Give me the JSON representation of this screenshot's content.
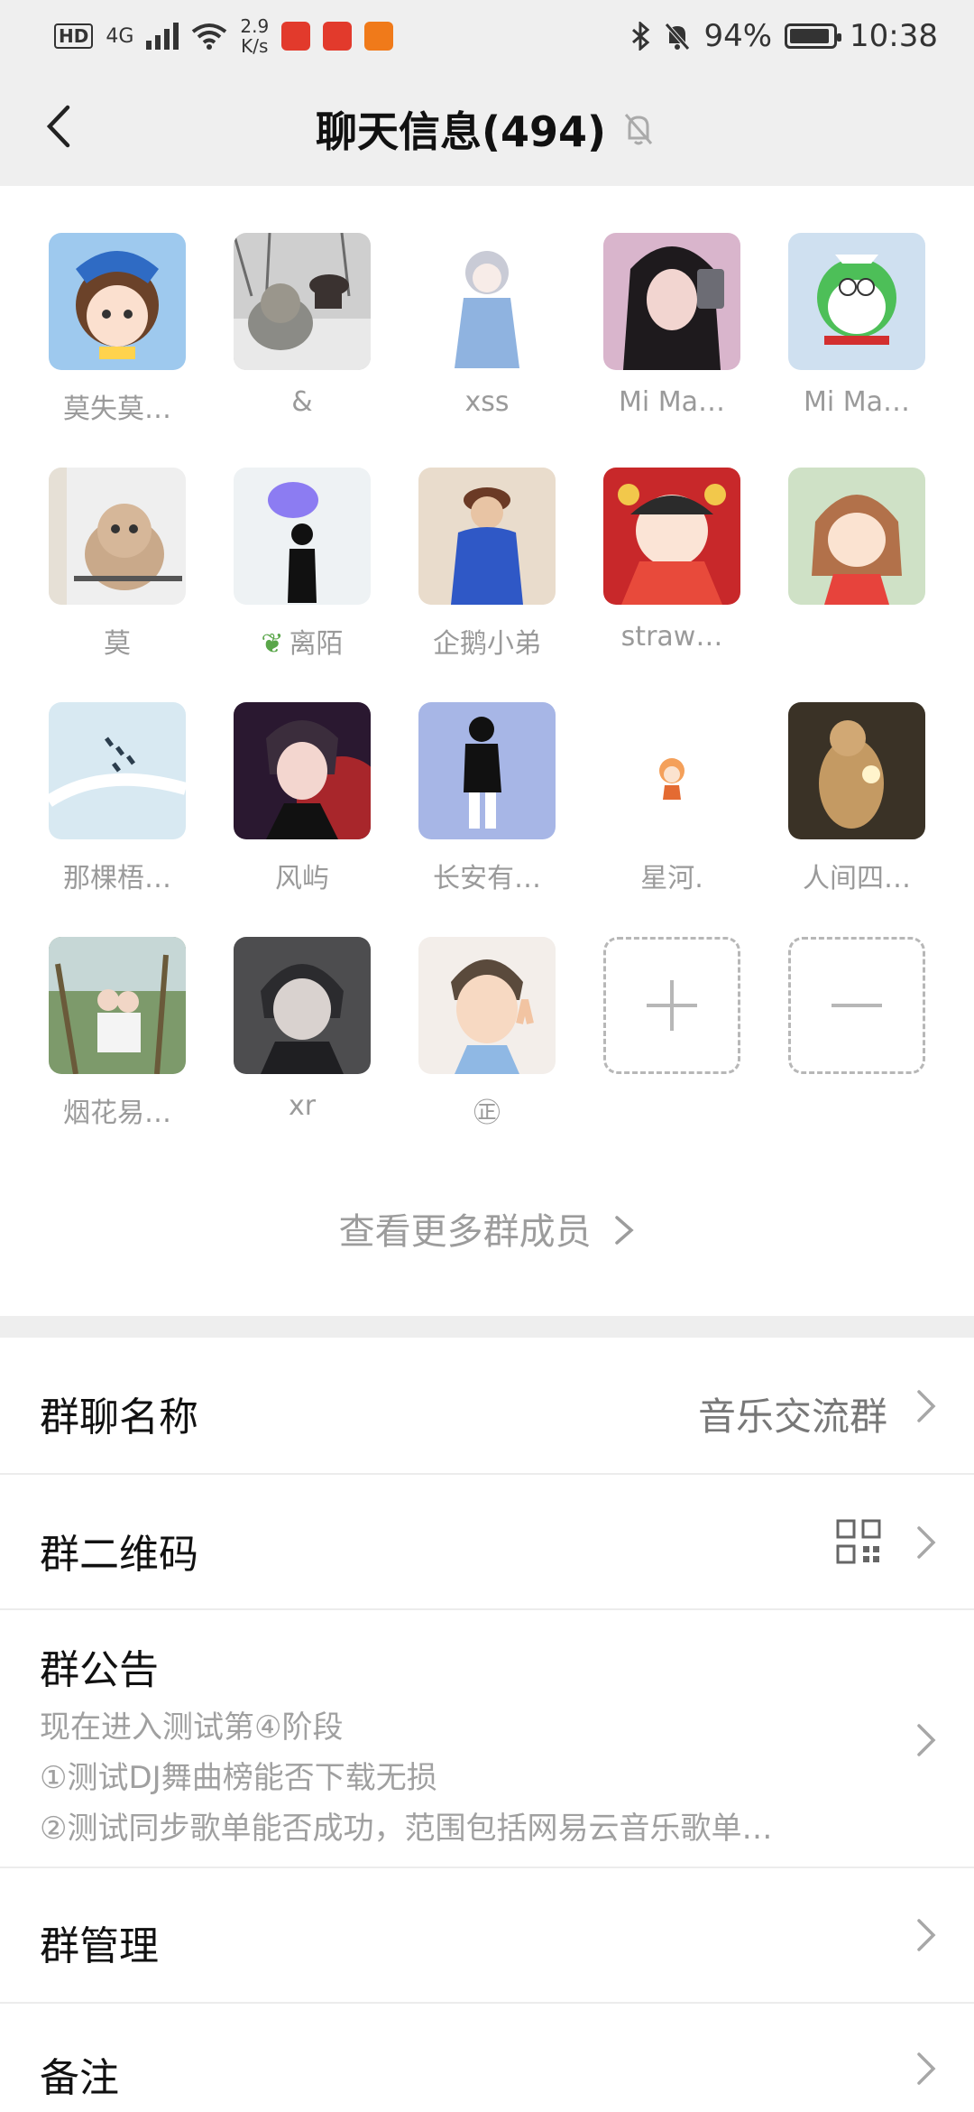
{
  "status_bar": {
    "hd": "HD",
    "network": "4G",
    "speed_value": "2.9",
    "speed_unit": "K/s",
    "battery": "94%",
    "battery_level": 0.94,
    "time": "10:38"
  },
  "header": {
    "title": "聊天信息(494)"
  },
  "members": [
    {
      "name": "莫失莫…"
    },
    {
      "name": "&"
    },
    {
      "name": "xss"
    },
    {
      "name": "Mi Ma…"
    },
    {
      "name": "Mi Ma…"
    },
    {
      "name": "莫"
    },
    {
      "name": "离陌"
    },
    {
      "name": "企鹅小弟"
    },
    {
      "name": "straw…"
    },
    {
      "name": ""
    },
    {
      "name": "那棵梧…"
    },
    {
      "name": "风屿"
    },
    {
      "name": "长安有…"
    },
    {
      "name": "星河."
    },
    {
      "name": "人间四…"
    },
    {
      "name": "烟花易…"
    },
    {
      "name": "xr"
    },
    {
      "name": "㊣"
    }
  ],
  "more_members": "查看更多群成员",
  "settings": {
    "group_name_label": "群聊名称",
    "group_name_value": "音乐交流群",
    "qr_label": "群二维码",
    "notice_label": "群公告",
    "notice_lines": [
      "现在进入测试第④阶段",
      "①测试DJ舞曲榜能否下载无损",
      "②测试同步歌单能否成功，范围包括网易云音乐歌单…"
    ],
    "manage_label": "群管理",
    "remark_label": "备注"
  },
  "colors": {
    "header_bg": "#efefef",
    "muted_text": "#9a9a9a",
    "divider": "#eeeeee"
  }
}
